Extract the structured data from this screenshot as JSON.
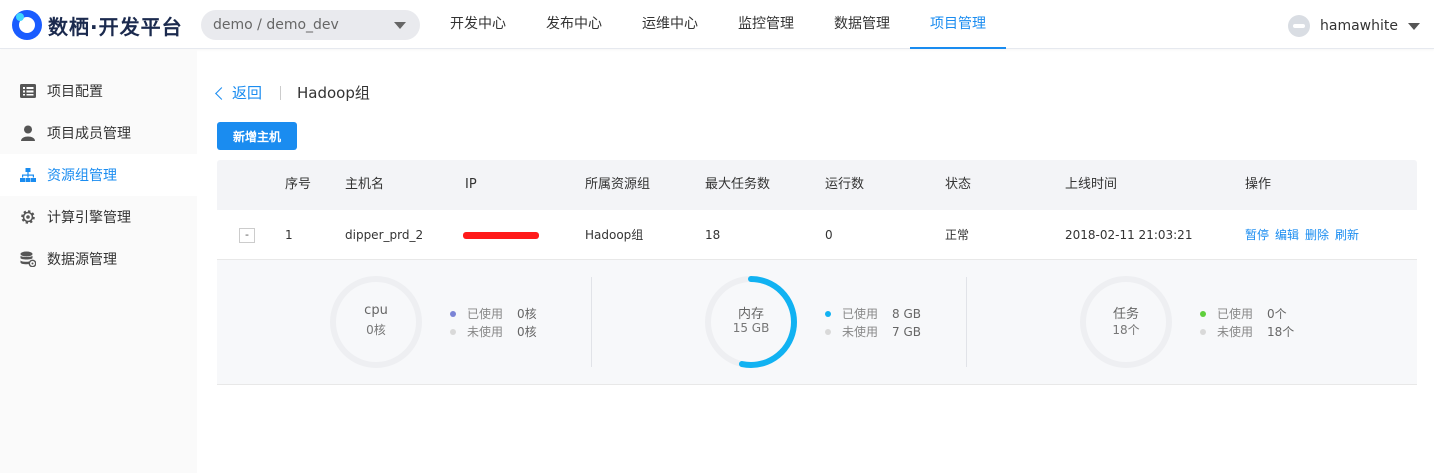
{
  "app": {
    "logo_text": "数栖·开发平台",
    "project_selector": "demo / demo_dev"
  },
  "nav": {
    "items": [
      "开发中心",
      "发布中心",
      "运维中心",
      "监控管理",
      "数据管理",
      "项目管理"
    ],
    "active_index": 5
  },
  "user": {
    "name": "hamawhite"
  },
  "sidebar": {
    "items": [
      {
        "label": "项目配置",
        "icon": "list-icon"
      },
      {
        "label": "项目成员管理",
        "icon": "user-icon"
      },
      {
        "label": "资源组管理",
        "icon": "sitemap-icon"
      },
      {
        "label": "计算引擎管理",
        "icon": "gear-icon"
      },
      {
        "label": "数据源管理",
        "icon": "database-icon"
      }
    ],
    "active_index": 2
  },
  "page": {
    "back_label": "返回",
    "title": "Hadoop组",
    "add_button": "新增主机"
  },
  "table": {
    "headers": [
      "序号",
      "主机名",
      "IP",
      "所属资源组",
      "最大任务数",
      "运行数",
      "状态",
      "上线时间",
      "操作"
    ],
    "rows": [
      {
        "expand": "-",
        "index": "1",
        "hostname": "dipper_prd_2",
        "ip": "",
        "group": "Hadoop组",
        "max_tasks": "18",
        "running": "0",
        "status": "正常",
        "online_time": "2018-02-11 21:03:21",
        "actions": [
          "暂停",
          "编辑",
          "删除",
          "刷新"
        ]
      }
    ]
  },
  "metrics": [
    {
      "title": "cpu",
      "total": "0核",
      "used_label": "已使用",
      "used_value": "0核",
      "free_label": "未使用",
      "free_value": "0核",
      "used_fraction": 0,
      "used_color": "#7b84d6",
      "free_color": "#d9d9d9"
    },
    {
      "title": "内存",
      "total": "15 GB",
      "used_label": "已使用",
      "used_value": "8 GB",
      "free_label": "未使用",
      "free_value": "7 GB",
      "used_fraction": 0.533,
      "used_color": "#11b2f2",
      "free_color": "#d9d9d9"
    },
    {
      "title": "任务",
      "total": "18个",
      "used_label": "已使用",
      "used_value": "0个",
      "free_label": "未使用",
      "free_value": "18个",
      "used_fraction": 0,
      "used_color": "#5fcf3c",
      "free_color": "#d9d9d9"
    }
  ],
  "colors": {
    "accent": "#1a8cf0",
    "ip_redaction": "#ff1a1a"
  }
}
